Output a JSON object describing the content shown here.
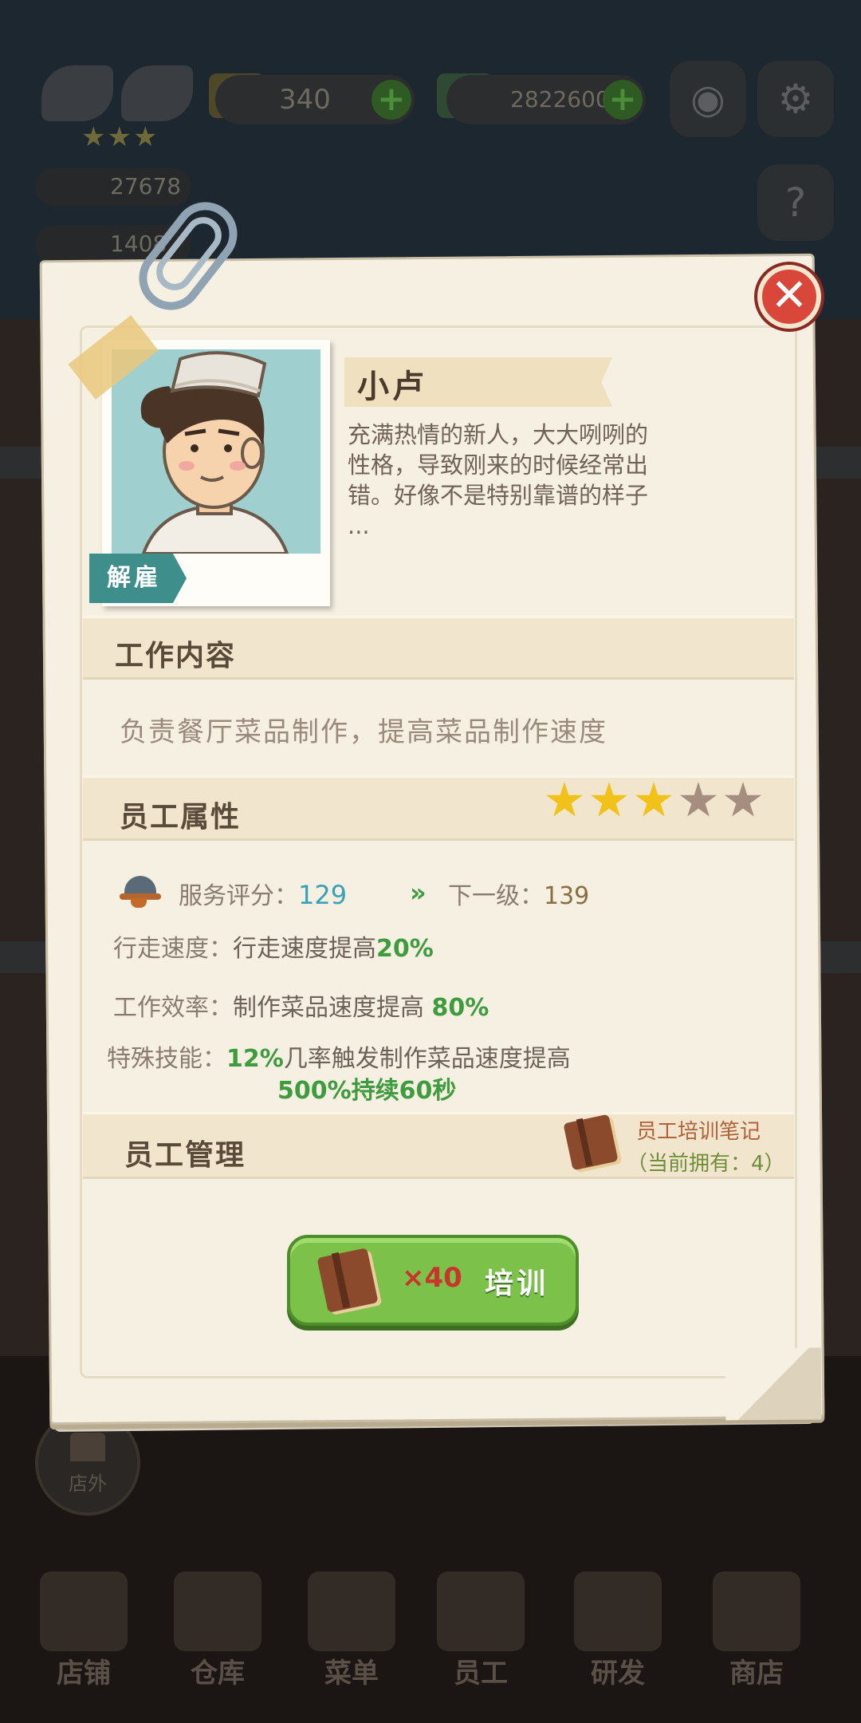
{
  "hud": {
    "coins": "340",
    "cash": "2822600",
    "stat_1": "27678",
    "stat_2": "1408"
  },
  "bottom_nav": {
    "outside": "店外",
    "tabs": [
      "店铺",
      "仓库",
      "菜单",
      "员工",
      "研发",
      "商店"
    ]
  },
  "employee": {
    "name": "小卢",
    "description_lines": [
      "充满热情的新人，大大咧咧的",
      "性格，导致刚来的时候经常出",
      "错。好像不是特别靠谱的样子",
      "..."
    ],
    "fire_label": "解雇",
    "stars_filled": 3,
    "stars_total": 5
  },
  "work": {
    "title": "工作内容",
    "content": "负责餐厅菜品制作，提高菜品制作速度"
  },
  "attributes": {
    "title": "员工属性",
    "service_label": "服务评分：",
    "service_value": "129",
    "next_label": "下一级：",
    "next_value": "139",
    "walk_label": "行走速度：",
    "walk_text": "行走速度提高",
    "walk_value": "20%",
    "eff_label": "工作效率：",
    "eff_text": "制作菜品速度提高",
    "eff_value": "80%",
    "skill_label": "特殊技能：",
    "skill_pct": "12%",
    "skill_text": "几率触发制作菜品速度提高",
    "skill_boost": "500%",
    "skill_duration": "持续60秒"
  },
  "management": {
    "title": "员工管理",
    "notes_label": "员工培训笔记",
    "notes_count": "（当前拥有：4）",
    "train_cost": "×40",
    "train_label": "培训"
  },
  "colors": {
    "star_on": "#f2c21a",
    "star_off": "#a58d80",
    "green_value": "#3e9b3e",
    "blue_value": "#3aa0b8",
    "button_green": "#7cc24a",
    "close_red": "#d9473a"
  }
}
